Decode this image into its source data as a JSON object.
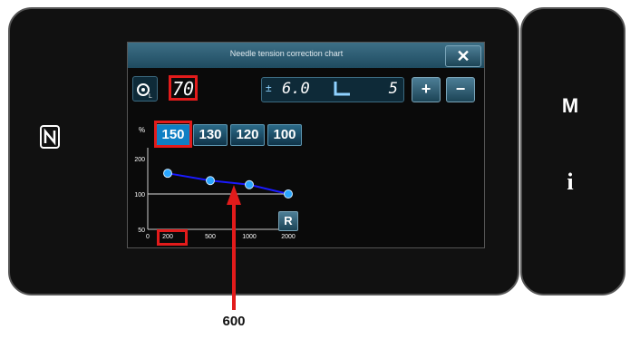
{
  "dialog": {
    "title": "Needle tension correction chart",
    "close_label": "✕"
  },
  "speed": {
    "icon": "stitch-speed-icon",
    "value": "70"
  },
  "tension": {
    "icon": "thread-tension-icon",
    "value": "6.0",
    "foot_icon": "presser-foot-icon",
    "foot_value": "5"
  },
  "buttons": {
    "plus": "+",
    "minus": "−",
    "reset": "R"
  },
  "options": {
    "unit": "%",
    "values": [
      "150",
      "130",
      "120",
      "100"
    ],
    "selected": "150"
  },
  "chart_data": {
    "type": "line",
    "x_ticks": [
      "0",
      "200",
      "500",
      "1000",
      "2000"
    ],
    "y_ticks": [
      "200",
      "100",
      "50"
    ],
    "series": [
      {
        "x": [
          200,
          500,
          1000,
          2000
        ],
        "values": [
          150,
          130,
          120,
          100
        ]
      }
    ],
    "ylim": [
      50,
      200
    ]
  },
  "callout": "600",
  "colors": {
    "highlight": "#e21b1b",
    "line": "#1a1aff",
    "point": "#2aa6ff"
  }
}
